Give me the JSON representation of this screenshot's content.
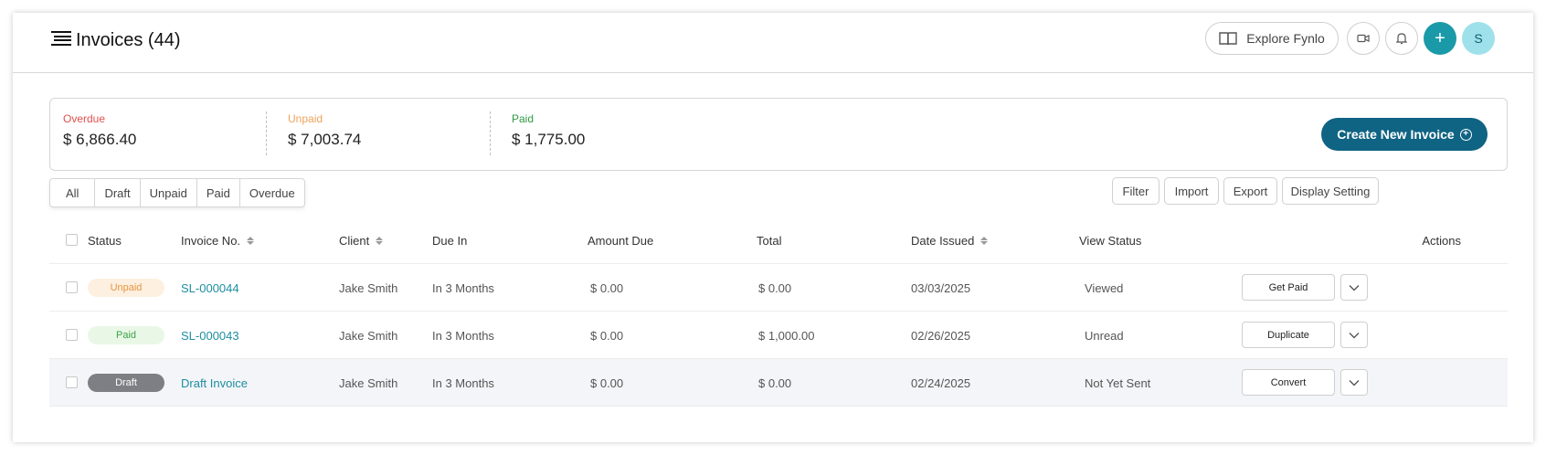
{
  "header": {
    "title": "Invoices (44)",
    "explore_label": "Explore Fynlo",
    "avatar_initial": "S",
    "plus_symbol": "+"
  },
  "summary": {
    "overdue": {
      "label": "Overdue",
      "value": "$ 6,866.40",
      "color": "#e0514e"
    },
    "unpaid": {
      "label": "Unpaid",
      "value": "$ 7,003.74",
      "color": "#f0a25a"
    },
    "paid": {
      "label": "Paid",
      "value": "$ 1,775.00",
      "color": "#2f9a44"
    },
    "create_label": "Create New Invoice"
  },
  "tabs": [
    "All",
    "Draft",
    "Unpaid",
    "Paid",
    "Overdue"
  ],
  "toolbar": {
    "filter": "Filter",
    "import": "Import",
    "export": "Export",
    "display": "Display Setting"
  },
  "table": {
    "columns": {
      "status": "Status",
      "invoice_no": "Invoice No.",
      "client": "Client",
      "due_in": "Due In",
      "amount_due": "Amount Due",
      "total": "Total",
      "date_issued": "Date Issued",
      "view_status": "View Status",
      "actions": "Actions"
    },
    "rows": [
      {
        "status": "Unpaid",
        "invoice_no": "SL-000044",
        "client": "Jake Smith",
        "due_in": "In 3 Months",
        "amount_due": "$ 0.00",
        "total": "$ 0.00",
        "date_issued": "03/03/2025",
        "view_status": "Viewed",
        "action": "Get Paid"
      },
      {
        "status": "Paid",
        "invoice_no": "SL-000043",
        "client": "Jake Smith",
        "due_in": "In 3 Months",
        "amount_due": "$ 0.00",
        "total": "$ 1,000.00",
        "date_issued": "02/26/2025",
        "view_status": "Unread",
        "action": "Duplicate"
      },
      {
        "status": "Draft",
        "invoice_no": "Draft Invoice",
        "client": "Jake Smith",
        "due_in": "In 3 Months",
        "amount_due": "$ 0.00",
        "total": "$ 0.00",
        "date_issued": "02/24/2025",
        "view_status": "Not Yet Sent",
        "action": "Convert"
      }
    ]
  },
  "colors": {
    "brand": "#0f6383",
    "accent": "#1a9aa8",
    "link": "#1e8ea0",
    "unpaid_badge_bg": "#fdf0e1",
    "unpaid_badge_fg": "#e8953f",
    "paid_badge_bg": "#e9f8e6",
    "paid_badge_fg": "#3aa447",
    "draft_badge_bg": "#7d7f84",
    "draft_badge_fg": "#ffffff"
  }
}
